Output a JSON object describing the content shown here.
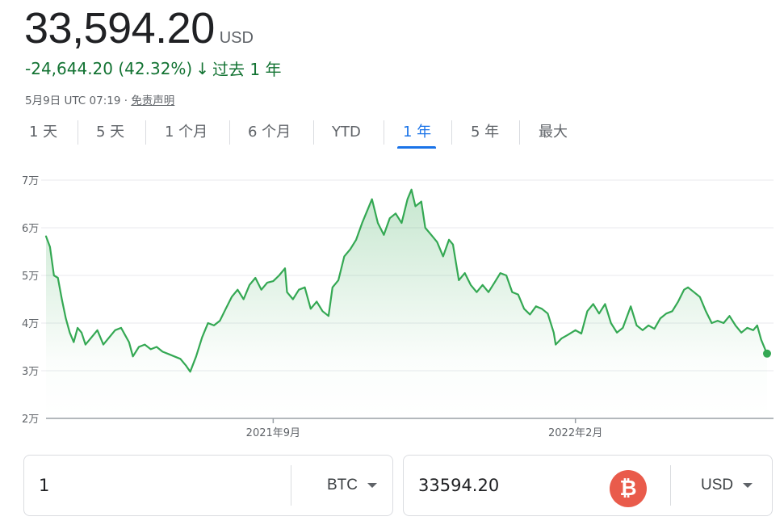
{
  "quote": {
    "price": "33,594.20",
    "currency": "USD",
    "change": "-24,644.20 (42.32%)",
    "change_arrow": "↓",
    "change_period": "过去 1 年",
    "timestamp": "5月9日 UTC 07:19 · ",
    "disclaimer": "免责声明",
    "change_color": "#137333"
  },
  "tabs": [
    {
      "label": "1 天"
    },
    {
      "label": "5 天"
    },
    {
      "label": "1 个月"
    },
    {
      "label": "6 个月"
    },
    {
      "label": "YTD"
    },
    {
      "label": "1 年",
      "active": true
    },
    {
      "label": "5 年"
    },
    {
      "label": "最大"
    }
  ],
  "colors": {
    "line": "#34a853",
    "accent": "#1a73e8",
    "grid": "#e8eaed",
    "axis": "#9aa0a6"
  },
  "chart_data": {
    "type": "area",
    "x_range": [
      "2021-05-09",
      "2022-05-09"
    ],
    "ylim": [
      20000,
      70000
    ],
    "y_tick_labels": [
      "7万",
      "6万",
      "5万",
      "4万",
      "3万",
      "2万"
    ],
    "y_tick_values": [
      70000,
      60000,
      50000,
      40000,
      30000,
      20000
    ],
    "x_tick_labels": [
      "2021年9月",
      "2022年2月"
    ],
    "x_tick_dates": [
      "2021-09-01",
      "2022-02-01"
    ],
    "series": [
      {
        "values": [
          [
            "2021-05-09",
            58200
          ],
          [
            "2021-05-11",
            56000
          ],
          [
            "2021-05-13",
            50000
          ],
          [
            "2021-05-15",
            49500
          ],
          [
            "2021-05-17",
            45000
          ],
          [
            "2021-05-19",
            41000
          ],
          [
            "2021-05-21",
            38000
          ],
          [
            "2021-05-23",
            36000
          ],
          [
            "2021-05-25",
            39000
          ],
          [
            "2021-05-27",
            38000
          ],
          [
            "2021-05-29",
            35500
          ],
          [
            "2021-06-01",
            37000
          ],
          [
            "2021-06-04",
            38500
          ],
          [
            "2021-06-07",
            35500
          ],
          [
            "2021-06-10",
            37000
          ],
          [
            "2021-06-13",
            38500
          ],
          [
            "2021-06-16",
            39000
          ],
          [
            "2021-06-18",
            37500
          ],
          [
            "2021-06-20",
            36000
          ],
          [
            "2021-06-22",
            33000
          ],
          [
            "2021-06-25",
            35000
          ],
          [
            "2021-06-28",
            35500
          ],
          [
            "2021-07-01",
            34500
          ],
          [
            "2021-07-04",
            35000
          ],
          [
            "2021-07-07",
            34000
          ],
          [
            "2021-07-10",
            33500
          ],
          [
            "2021-07-13",
            33000
          ],
          [
            "2021-07-16",
            32500
          ],
          [
            "2021-07-19",
            31000
          ],
          [
            "2021-07-21",
            29800
          ],
          [
            "2021-07-24",
            33000
          ],
          [
            "2021-07-27",
            37000
          ],
          [
            "2021-07-30",
            40000
          ],
          [
            "2021-08-02",
            39500
          ],
          [
            "2021-08-05",
            40500
          ],
          [
            "2021-08-08",
            43000
          ],
          [
            "2021-08-11",
            45500
          ],
          [
            "2021-08-14",
            47000
          ],
          [
            "2021-08-17",
            45000
          ],
          [
            "2021-08-20",
            48000
          ],
          [
            "2021-08-23",
            49500
          ],
          [
            "2021-08-26",
            47000
          ],
          [
            "2021-08-29",
            48500
          ],
          [
            "2021-09-01",
            48800
          ],
          [
            "2021-09-04",
            50000
          ],
          [
            "2021-09-07",
            51500
          ],
          [
            "2021-09-08",
            46500
          ],
          [
            "2021-09-11",
            45000
          ],
          [
            "2021-09-14",
            47000
          ],
          [
            "2021-09-17",
            47500
          ],
          [
            "2021-09-20",
            43000
          ],
          [
            "2021-09-23",
            44500
          ],
          [
            "2021-09-26",
            42500
          ],
          [
            "2021-09-29",
            41500
          ],
          [
            "2021-10-01",
            47500
          ],
          [
            "2021-10-04",
            49000
          ],
          [
            "2021-10-07",
            54000
          ],
          [
            "2021-10-10",
            55500
          ],
          [
            "2021-10-13",
            57500
          ],
          [
            "2021-10-16",
            61000
          ],
          [
            "2021-10-19",
            64000
          ],
          [
            "2021-10-21",
            66000
          ],
          [
            "2021-10-24",
            61000
          ],
          [
            "2021-10-27",
            58500
          ],
          [
            "2021-10-30",
            62000
          ],
          [
            "2021-11-02",
            63000
          ],
          [
            "2021-11-05",
            61000
          ],
          [
            "2021-11-08",
            66000
          ],
          [
            "2021-11-10",
            68000
          ],
          [
            "2021-11-12",
            64500
          ],
          [
            "2021-11-15",
            65500
          ],
          [
            "2021-11-17",
            60000
          ],
          [
            "2021-11-20",
            58500
          ],
          [
            "2021-11-23",
            57000
          ],
          [
            "2021-11-26",
            54000
          ],
          [
            "2021-11-29",
            57500
          ],
          [
            "2021-12-01",
            56500
          ],
          [
            "2021-12-04",
            49000
          ],
          [
            "2021-12-07",
            50500
          ],
          [
            "2021-12-10",
            48000
          ],
          [
            "2021-12-13",
            46500
          ],
          [
            "2021-12-16",
            48000
          ],
          [
            "2021-12-19",
            46500
          ],
          [
            "2021-12-22",
            48500
          ],
          [
            "2021-12-25",
            50500
          ],
          [
            "2021-12-28",
            50000
          ],
          [
            "2021-12-31",
            46500
          ],
          [
            "2022-01-03",
            46000
          ],
          [
            "2022-01-06",
            43000
          ],
          [
            "2022-01-09",
            41800
          ],
          [
            "2022-01-12",
            43500
          ],
          [
            "2022-01-15",
            43000
          ],
          [
            "2022-01-18",
            42000
          ],
          [
            "2022-01-21",
            38000
          ],
          [
            "2022-01-22",
            35500
          ],
          [
            "2022-01-25",
            36800
          ],
          [
            "2022-01-28",
            37500
          ],
          [
            "2022-02-01",
            38500
          ],
          [
            "2022-02-04",
            37800
          ],
          [
            "2022-02-07",
            42500
          ],
          [
            "2022-02-10",
            44000
          ],
          [
            "2022-02-13",
            42000
          ],
          [
            "2022-02-16",
            44000
          ],
          [
            "2022-02-19",
            40000
          ],
          [
            "2022-02-22",
            38000
          ],
          [
            "2022-02-25",
            39000
          ],
          [
            "2022-03-01",
            43500
          ],
          [
            "2022-03-04",
            39500
          ],
          [
            "2022-03-07",
            38500
          ],
          [
            "2022-03-10",
            39500
          ],
          [
            "2022-03-13",
            38800
          ],
          [
            "2022-03-16",
            41000
          ],
          [
            "2022-03-19",
            42000
          ],
          [
            "2022-03-22",
            42500
          ],
          [
            "2022-03-25",
            44500
          ],
          [
            "2022-03-28",
            47000
          ],
          [
            "2022-03-30",
            47500
          ],
          [
            "2022-04-02",
            46500
          ],
          [
            "2022-04-05",
            45500
          ],
          [
            "2022-04-08",
            42500
          ],
          [
            "2022-04-11",
            40000
          ],
          [
            "2022-04-14",
            40500
          ],
          [
            "2022-04-17",
            40000
          ],
          [
            "2022-04-20",
            41500
          ],
          [
            "2022-04-23",
            39500
          ],
          [
            "2022-04-26",
            38000
          ],
          [
            "2022-04-29",
            39000
          ],
          [
            "2022-05-02",
            38500
          ],
          [
            "2022-05-04",
            39500
          ],
          [
            "2022-05-06",
            36500
          ],
          [
            "2022-05-08",
            34500
          ],
          [
            "2022-05-09",
            33594.2
          ]
        ]
      }
    ]
  },
  "converter": {
    "from_value": "1",
    "from_currency": "BTC",
    "to_value": "33594.20",
    "to_currency": "USD",
    "watermark_icon": "bitcoin-logo-icon",
    "watermark_symbol": "₿"
  }
}
